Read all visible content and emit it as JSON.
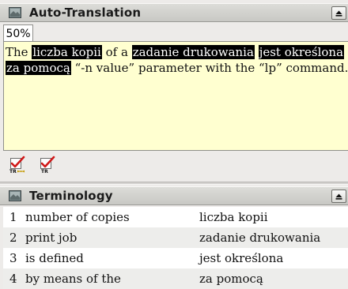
{
  "auto_translation": {
    "title": "Auto-Translation",
    "icon": "pane-icon",
    "tab_label": "50%",
    "text_segments": [
      {
        "text": "The ",
        "highlight": false
      },
      {
        "text": "liczba kopii",
        "highlight": true
      },
      {
        "text": " of a ",
        "highlight": false
      },
      {
        "text": "zadanie drukowania",
        "highlight": true
      },
      {
        "text": " ",
        "highlight": false
      },
      {
        "text": "jest określona",
        "highlight": true
      },
      {
        "text": "za pomocą",
        "highlight": true
      },
      {
        "text": " “-n value” parameter with the “lp” command.",
        "highlight": false
      }
    ],
    "toolbar": [
      {
        "icon": "insert-translation-icon",
        "caption": "TR"
      },
      {
        "icon": "replace-translation-icon",
        "caption": "TR"
      }
    ],
    "colors": {
      "background": "#ffffd0",
      "highlight_bg": "#000000",
      "highlight_fg": "#ffffff"
    }
  },
  "terminology": {
    "title": "Terminology",
    "icon": "pane-icon",
    "rows": [
      {
        "num": "1",
        "source": "number of copies",
        "target": "liczba kopii"
      },
      {
        "num": "2",
        "source": "print job",
        "target": "zadanie drukowania"
      },
      {
        "num": "3",
        "source": "is defined",
        "target": "jest określona"
      },
      {
        "num": "4",
        "source": "by means of the",
        "target": "za pomocą"
      }
    ]
  }
}
